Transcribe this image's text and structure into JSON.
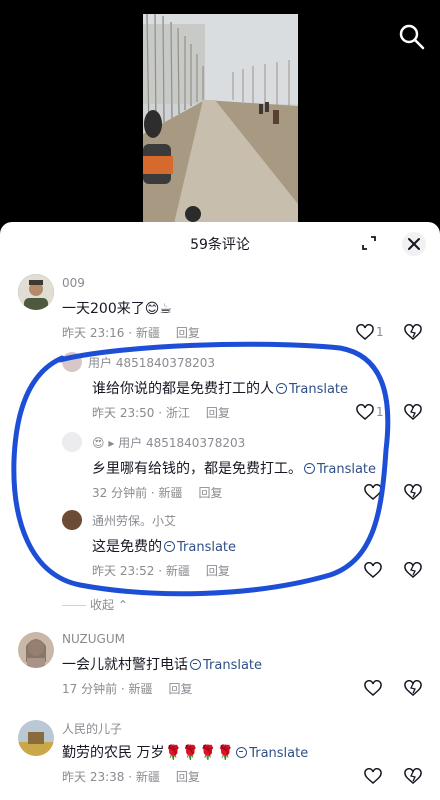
{
  "sheet": {
    "title": "59条评论"
  },
  "comments": [
    {
      "user": "009",
      "text": "一天200来了😊☕",
      "time": "昨天 23:16 · 新疆",
      "reply": "回复",
      "likes": "1"
    },
    {
      "user": "用户 4851840378203",
      "text": "谁给你说的都是免费打工的人",
      "translate": "Translate",
      "time": "昨天 23:50 · 浙江",
      "reply": "回复",
      "likes": "1"
    },
    {
      "user": "😍 ▸ 用户 4851840378203",
      "text": "乡里哪有给钱的，都是免费打工。",
      "translate": "Translate",
      "time": "32 分钟前 · 新疆",
      "reply": "回复"
    },
    {
      "user": "通州劳保。小艾",
      "text": "这是免费的",
      "translate": "Translate",
      "time": "昨天 23:52 · 新疆",
      "reply": "回复"
    },
    {
      "user": "NUZUGUM",
      "text": "一会儿就村警打电话",
      "translate": "Translate",
      "time": "17 分钟前 · 新疆",
      "reply": "回复"
    },
    {
      "user": "人民的儿子",
      "text": "勤劳的农民 万岁🌹🌹🌹🌹",
      "translate": "Translate",
      "time": "昨天 23:38 · 新疆",
      "reply": "回复"
    }
  ],
  "collapse_label": "收起",
  "colors": {
    "annotation": "#1d4fd6",
    "translate": "#2f4f86",
    "meta": "#8a8b91"
  },
  "icons": [
    "search-icon",
    "expand-icon",
    "close-icon",
    "heart-icon",
    "dislike-icon",
    "translate-icon"
  ]
}
